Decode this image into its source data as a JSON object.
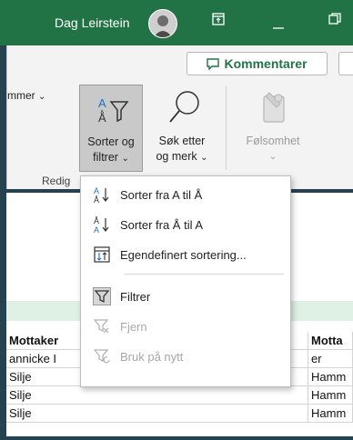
{
  "titlebar": {
    "user_name": "Dag Leirstein",
    "buttons": [
      "ribbon-display-icon",
      "minimize-icon",
      "restore-icon"
    ]
  },
  "ribbon": {
    "comments_label": "Kommentarer",
    "partial_label": "mmer",
    "sort_filter_line1": "Sorter og",
    "sort_filter_line2": "filtrer",
    "find_select_line1": "Søk etter",
    "find_select_line2": "og merk",
    "sensitivity_label": "Følsomhet",
    "group_label": "Redig"
  },
  "menu": {
    "items": [
      {
        "label": "Sorter fra A til Å",
        "icon": "sort-ascending-icon",
        "enabled": true
      },
      {
        "label": "Sorter fra Å til A",
        "icon": "sort-descending-icon",
        "enabled": true
      },
      {
        "label": "Egendefinert sortering...",
        "icon": "custom-sort-icon",
        "enabled": true
      },
      {
        "label": "Filtrer",
        "icon": "filter-icon",
        "enabled": true
      },
      {
        "label": "Fjern",
        "icon": "clear-filter-icon",
        "enabled": false
      },
      {
        "label": "Bruk på nytt",
        "icon": "reapply-filter-icon",
        "enabled": false
      }
    ]
  },
  "sheet": {
    "headers": [
      "Mottaker",
      "Motta"
    ],
    "rows": [
      [
        "annicke I",
        "er"
      ],
      [
        "Silje",
        "Hamm"
      ],
      [
        "Silje",
        "Hamm"
      ],
      [
        "Silje",
        "Hamm"
      ]
    ]
  },
  "colors": {
    "excel_green": "#217346",
    "frame": "#24424f",
    "ribbon_bg": "#f3f3f3"
  }
}
